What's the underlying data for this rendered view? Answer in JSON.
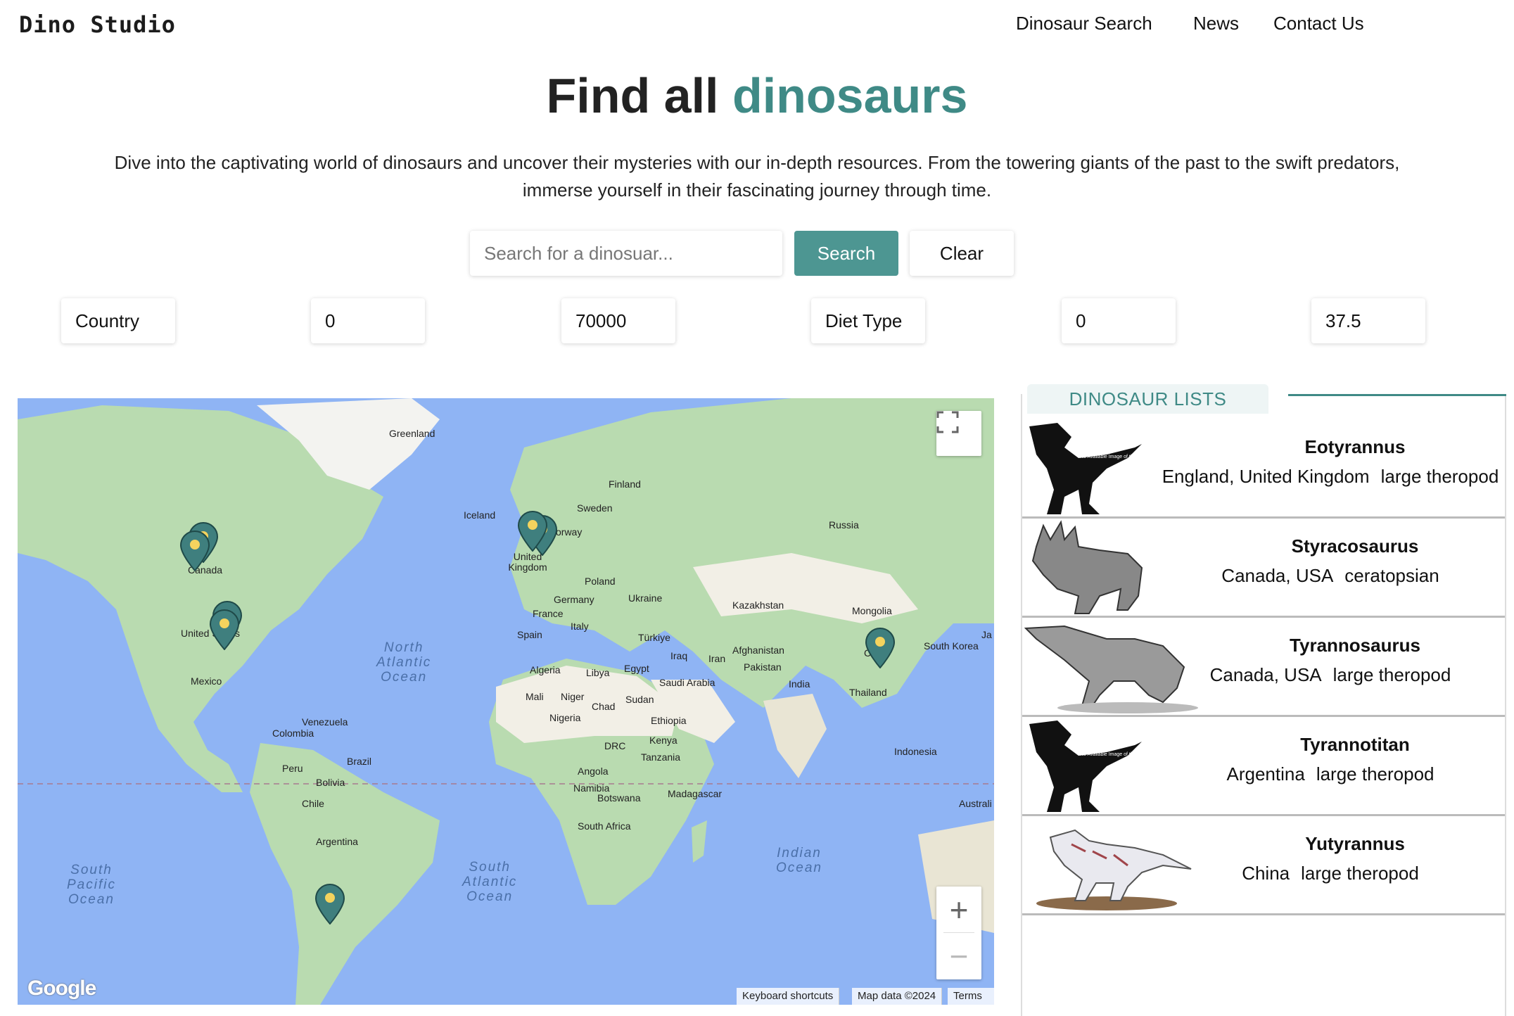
{
  "brand": "Dino Studio",
  "nav": {
    "items": [
      "Dinosaur Search",
      "News",
      "Contact Us"
    ]
  },
  "hero": {
    "title_prefix": "Find all ",
    "title_accent": "dinosaurs",
    "description": "Dive into the captivating world of dinosaurs and uncover their mysteries with our in-depth resources. From the towering giants of the past to the swift predators, immerse yourself in their fascinating journey through time."
  },
  "search": {
    "placeholder": "Search for a dinosuar...",
    "value": "",
    "search_label": "Search",
    "clear_label": "Clear"
  },
  "filters": [
    {
      "value": "Country"
    },
    {
      "value": "0"
    },
    {
      "value": "70000"
    },
    {
      "value": "Diet Type"
    },
    {
      "value": "0"
    },
    {
      "value": "37.5"
    }
  ],
  "map": {
    "labels": {
      "greenland": "Greenland",
      "iceland": "Iceland",
      "finland": "Finland",
      "sweden": "Sweden",
      "norway": "orway",
      "russia": "Russia",
      "canada": "Canada",
      "uk": "United Kingdom",
      "poland": "Poland",
      "germany": "Germany",
      "ukraine": "Ukraine",
      "france": "France",
      "kazakhstan": "Kazakhstan",
      "mongolia": "Mongolia",
      "italy": "Italy",
      "spain": "Spain",
      "turkiye": "Türkiye",
      "usa": "United States",
      "iraq": "Iraq",
      "iran": "Iran",
      "afghanistan": "Afghanistan",
      "pakistan": "Pakistan",
      "south_korea": "South Korea",
      "japan": "Ja",
      "algeria": "Algeria",
      "libya": "Libya",
      "egypt": "Egypt",
      "saudi": "Saudi Arabia",
      "india": "India",
      "mexico": "Mexico",
      "thailand": "Thailand",
      "mali": "Mali",
      "niger": "Niger",
      "chad": "Chad",
      "sudan": "Sudan",
      "nigeria": "Nigeria",
      "ethiopia": "Ethiopia",
      "venezuela": "Venezuela",
      "colombia": "Colombia",
      "kenya": "Kenya",
      "drc": "DRC",
      "tanzania": "Tanzania",
      "indonesia": "Indonesia",
      "peru": "Peru",
      "brazil": "Brazil",
      "bolivia": "Bolivia",
      "angola": "Angola",
      "namibia": "Namibia",
      "botswana": "Botswana",
      "madagascar": "Madagascar",
      "chile": "Chile",
      "south_africa": "South Africa",
      "argentina": "Argentina",
      "australia": "Australi",
      "china": "Ch"
    },
    "oceans": {
      "north_atlantic": "North\nAtlantic\nOcean",
      "south_pacific": "South\nPacific\nOcean",
      "south_atlantic": "South\nAtlantic\nOcean",
      "indian": "Indian\nOcean"
    },
    "attribution": {
      "keyboard": "Keyboard shortcuts",
      "data": "Map data ©2024",
      "terms": "Terms"
    },
    "google_logo": "Google",
    "colors": {
      "water": "#8fb4f4",
      "land": "#b9dbb0",
      "desert": "#f2efe6",
      "marker": "#3f7f7e",
      "marker_dot": "#f4d35e"
    }
  },
  "list": {
    "tab_label": "DINOSAUR LISTS",
    "items": [
      {
        "name": "Eotyrannus",
        "location": "England, United Kingdom",
        "diet": "large theropod",
        "image": "no-image-placeholder"
      },
      {
        "name": "Styracosaurus",
        "location": "Canada, USA",
        "diet": "ceratopsian",
        "image": "styracosaurus-illustration"
      },
      {
        "name": "Tyrannosaurus",
        "location": "Canada, USA",
        "diet": "large theropod",
        "image": "tyrannosaurus-illustration"
      },
      {
        "name": "Tyrannotitan",
        "location": "Argentina",
        "diet": "large theropod",
        "image": "no-image-placeholder"
      },
      {
        "name": "Yutyrannus",
        "location": "China",
        "diet": "large theropod",
        "image": "yutyrannus-illustration"
      }
    ],
    "placeholder_text": "No Available Image of this Dinosaur"
  }
}
